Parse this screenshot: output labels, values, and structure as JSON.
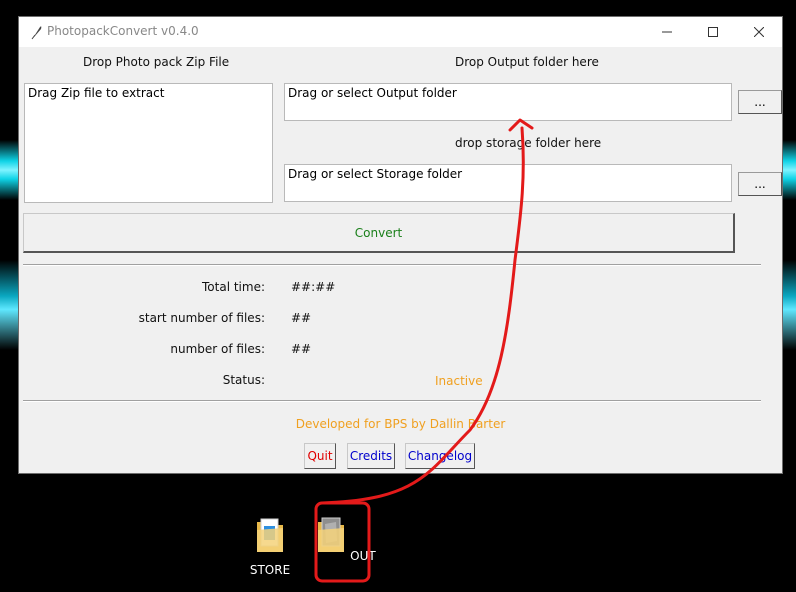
{
  "window": {
    "title": "PhotopackConvert v0.4.0",
    "controls": {
      "minimize_icon": "minimize-icon",
      "maximize_icon": "maximize-icon",
      "close_icon": "close-icon"
    }
  },
  "zip_section": {
    "label": "Drop Photo pack Zip File",
    "box_text": "Drag Zip file to extract"
  },
  "output_section": {
    "label": "Drop Output folder here",
    "field_text": "Drag or select Output folder",
    "browse_label": "..."
  },
  "storage_section": {
    "label": "drop storage folder here",
    "field_text": "Drag or select Storage folder",
    "browse_label": "..."
  },
  "convert_button": {
    "label": "Convert",
    "color": "#1a7f1a"
  },
  "stats": {
    "total_time": {
      "label": "Total time:",
      "value": "##:##"
    },
    "start_files": {
      "label": "start number of files:",
      "value": "##"
    },
    "files": {
      "label": "number of files:",
      "value": "##"
    },
    "status": {
      "label": "Status:",
      "value": "Inactive"
    }
  },
  "footer": {
    "credit_line": "Developed for BPS by Dallin Barter",
    "quit_label": "Quit",
    "credits_label": "Credits",
    "changelog_label": "Changelog",
    "colors": {
      "quit": "#e00000",
      "credits": "#0000cc",
      "changelog": "#0000cc",
      "accent": "#f0a020"
    }
  },
  "desktop": {
    "icons": [
      {
        "label": "STORE",
        "icon": "folder-icon"
      },
      {
        "label": "OUT",
        "icon": "folder-icon"
      }
    ]
  },
  "annotation": {
    "color": "#e31a1a"
  }
}
